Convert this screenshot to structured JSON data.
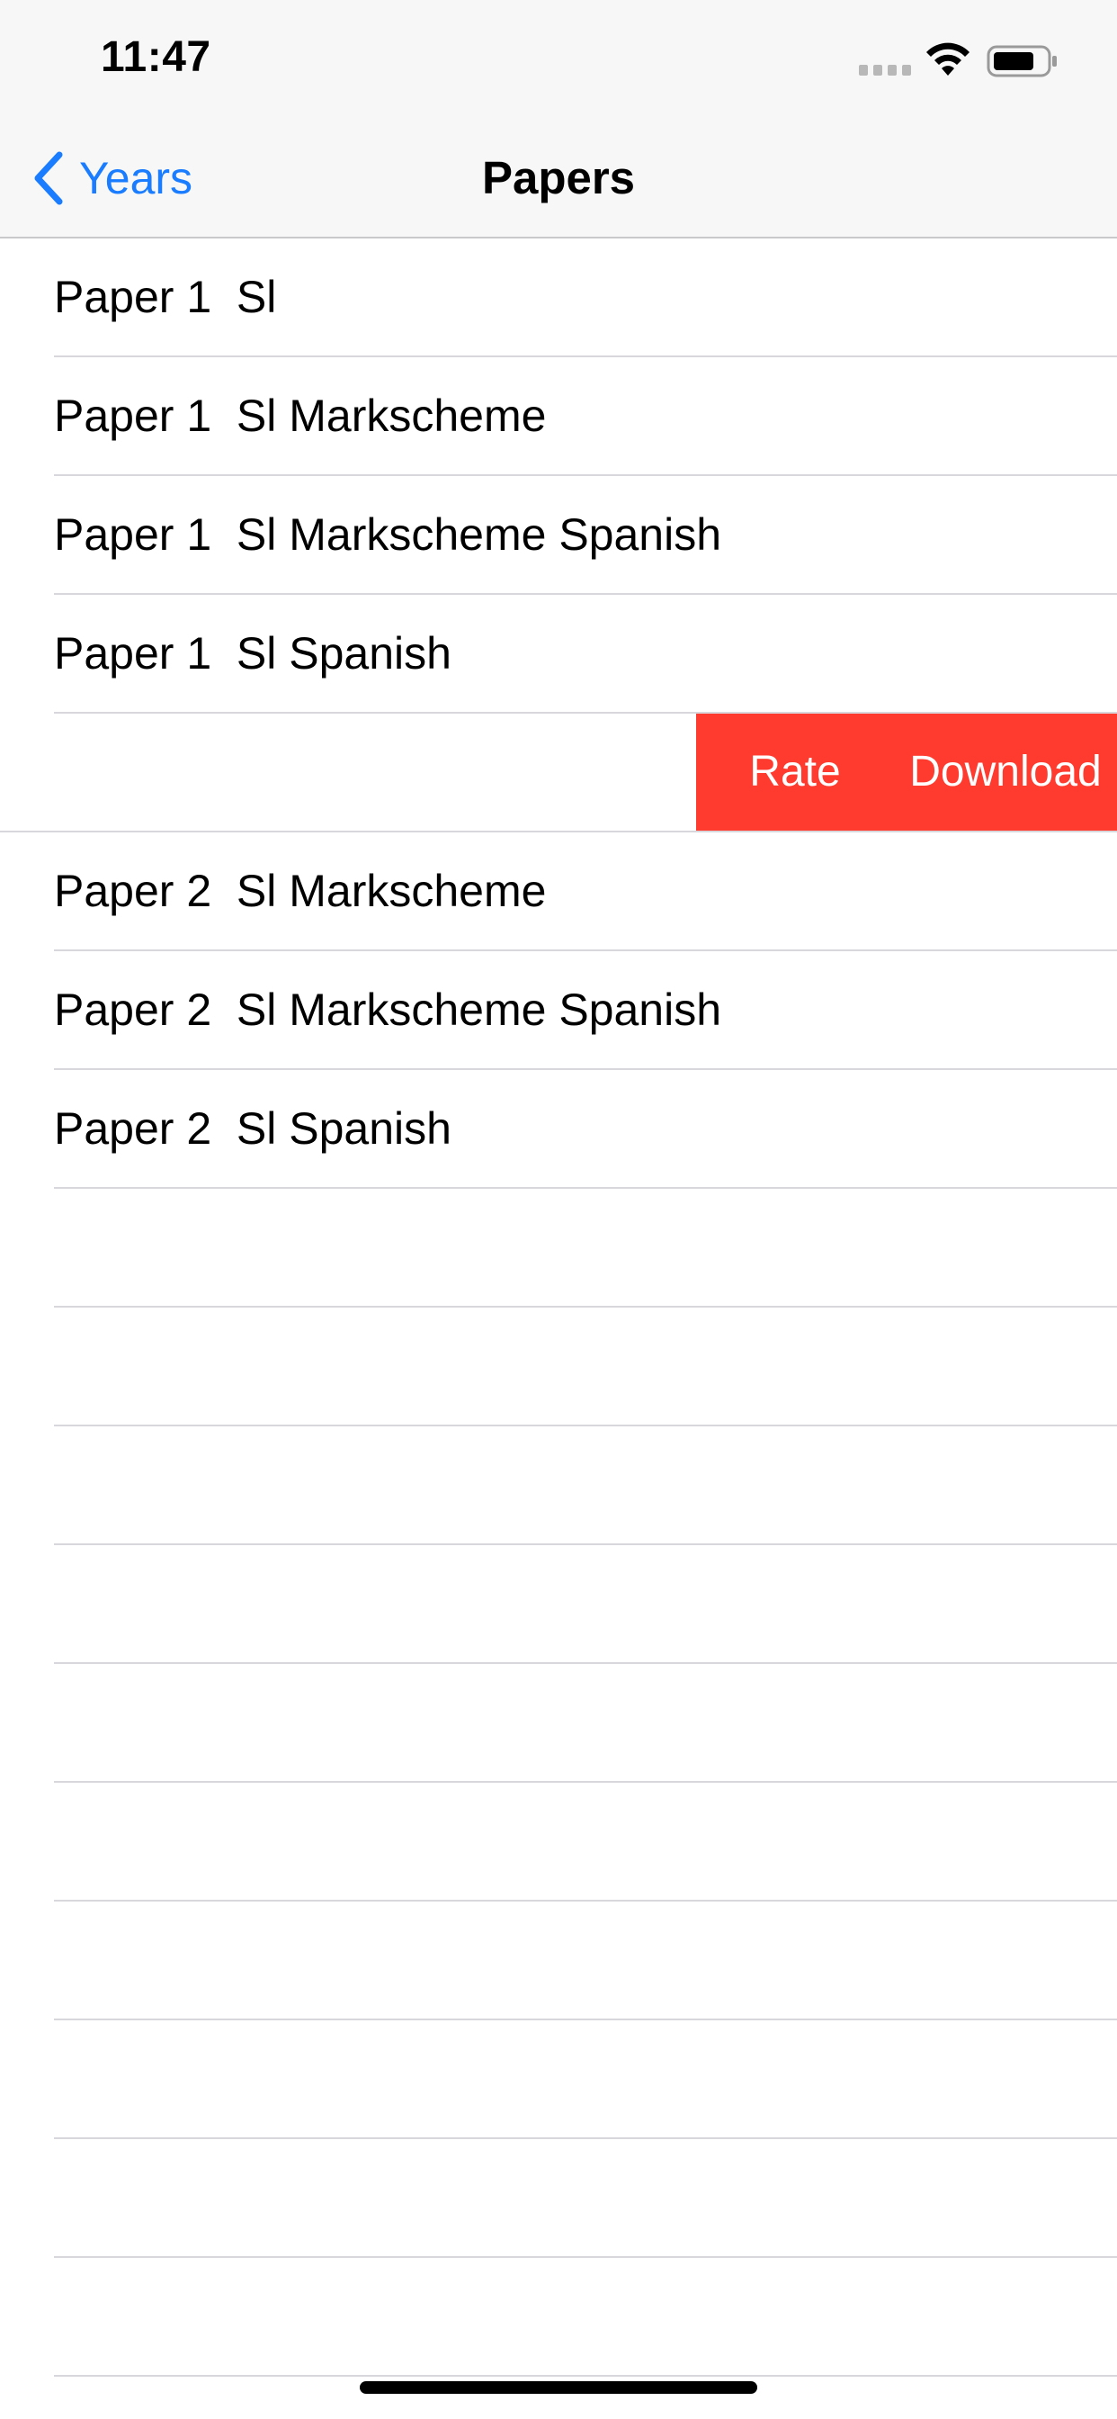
{
  "status_bar": {
    "time": "11:47",
    "icons": [
      "signal-dots-icon",
      "wifi-icon",
      "battery-icon"
    ]
  },
  "nav": {
    "back_label": "Years",
    "back_icon": "chevron-left-icon",
    "title": "Papers"
  },
  "rows": [
    {
      "label": "Paper 1  Sl"
    },
    {
      "label": "Paper 1  Sl Markscheme"
    },
    {
      "label": "Paper 1  Sl Markscheme Spanish"
    },
    {
      "label": "Paper 1  Sl Spanish"
    },
    {
      "label": ""
    },
    {
      "label": "Paper 2  Sl Markscheme"
    },
    {
      "label": "Paper 2  Sl Markscheme Spanish"
    },
    {
      "label": "Paper 2  Sl Spanish"
    }
  ],
  "swipe_actions": {
    "rate_label": "Rate",
    "download_label": "Download",
    "background_color": "#ff3b30"
  },
  "colors": {
    "accent": "#1a7cff",
    "destructive": "#ff3b30",
    "bar_background": "#f7f7f7"
  }
}
